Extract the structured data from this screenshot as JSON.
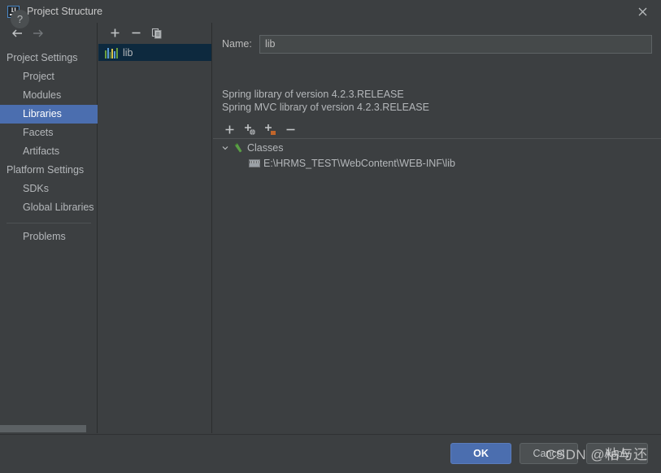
{
  "window": {
    "title": "Project Structure",
    "logo_text": "IJ",
    "close_icon": "close-icon"
  },
  "nav": {
    "back_icon": "arrow-left-icon",
    "forward_icon": "arrow-right-icon"
  },
  "sidebar": {
    "items": [
      {
        "label": "Project Settings",
        "type": "group",
        "selected": false
      },
      {
        "label": "Project",
        "type": "child",
        "selected": false
      },
      {
        "label": "Modules",
        "type": "child",
        "selected": false
      },
      {
        "label": "Libraries",
        "type": "child",
        "selected": true
      },
      {
        "label": "Facets",
        "type": "child",
        "selected": false
      },
      {
        "label": "Artifacts",
        "type": "child",
        "selected": false
      },
      {
        "label": "Platform Settings",
        "type": "group",
        "selected": false
      },
      {
        "label": "SDKs",
        "type": "child",
        "selected": false
      },
      {
        "label": "Global Libraries",
        "type": "child",
        "selected": false
      }
    ],
    "problems_label": "Problems",
    "selection_color": "#4b6eaf"
  },
  "library_list": {
    "toolbar": [
      {
        "icon": "plus-icon",
        "name": "add-library-button"
      },
      {
        "icon": "minus-icon",
        "name": "remove-library-button"
      },
      {
        "icon": "copy-icon",
        "name": "copy-library-button"
      }
    ],
    "items": [
      {
        "label": "lib",
        "icon": "library-icon",
        "selected": true
      }
    ],
    "selection_color": "#0d293e"
  },
  "detail": {
    "name_label": "Name:",
    "name_value": "lib",
    "name_placeholder": "",
    "descriptions": [
      "Spring library of version 4.2.3.RELEASE",
      "Spring MVC library of version 4.2.3.RELEASE"
    ],
    "toolbar": [
      {
        "icon": "plus-icon",
        "name": "add-root-button"
      },
      {
        "icon": "plus-globe-icon",
        "name": "add-url-root-button"
      },
      {
        "icon": "plus-folder-icon",
        "name": "add-directory-root-button"
      },
      {
        "icon": "minus-icon",
        "name": "remove-root-button"
      }
    ],
    "roots": [
      {
        "label": "Classes",
        "level": 0,
        "icon": "classes-hammer-icon",
        "expanded": true,
        "chevron": "chevron-down-icon"
      },
      {
        "label": "E:\\HRMS_TEST\\WebContent\\WEB-INF\\lib",
        "level": 1,
        "icon": "jar-folder-icon",
        "expanded": false,
        "chevron": ""
      }
    ]
  },
  "footer": {
    "help_label": "?",
    "ok_label": "OK",
    "cancel_label": "Cancel",
    "apply_label": "Apply",
    "ok_color": "#4b6eaf"
  },
  "watermark": {
    "text": "CSDN @粘与还"
  }
}
